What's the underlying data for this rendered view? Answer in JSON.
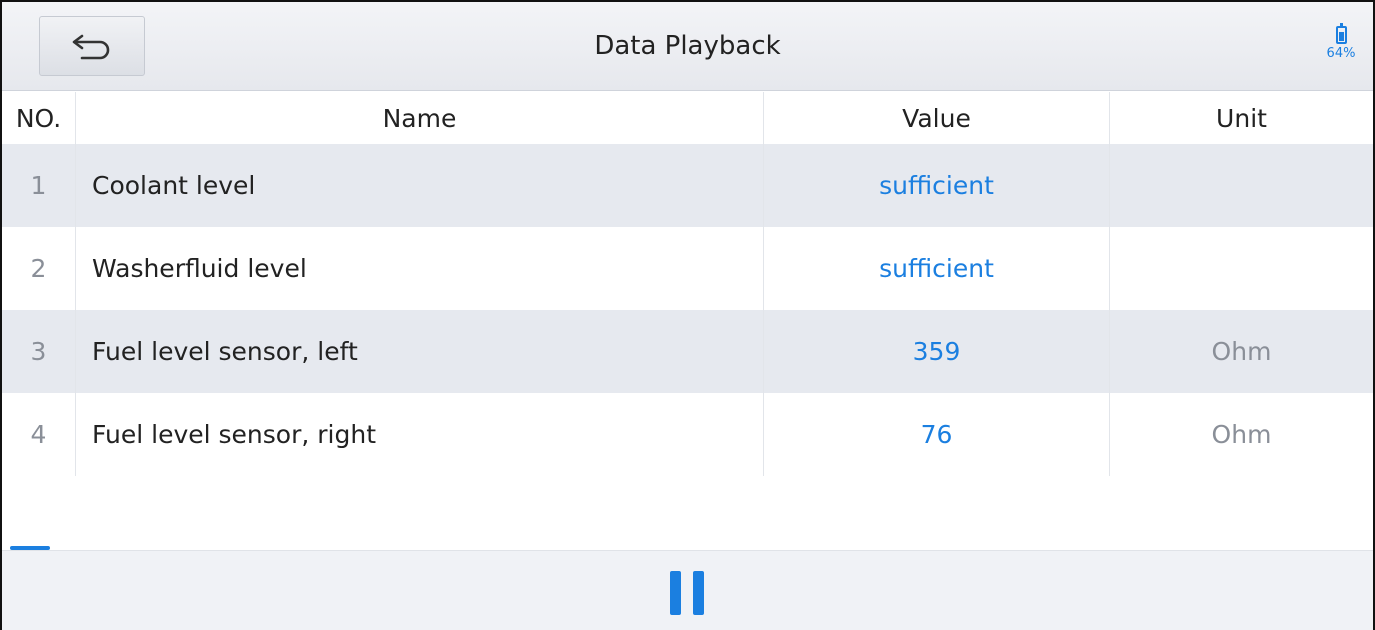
{
  "header": {
    "title": "Data Playback",
    "battery_text": "64%",
    "battery_level": 0.64,
    "back_icon": "back-arrow-icon"
  },
  "table": {
    "columns": [
      "NO.",
      "Name",
      "Value",
      "Unit"
    ],
    "rows": [
      {
        "no": "1",
        "name": "Coolant level",
        "value": "sufficient",
        "unit": ""
      },
      {
        "no": "2",
        "name": "Washerfluid level",
        "value": "sufficient",
        "unit": ""
      },
      {
        "no": "3",
        "name": "Fuel level sensor, left",
        "value": "359",
        "unit": "Ohm"
      },
      {
        "no": "4",
        "name": "Fuel level sensor, right",
        "value": "76",
        "unit": "Ohm"
      }
    ]
  },
  "playback": {
    "progress": 0.03,
    "control_icon": "pause-icon"
  },
  "colors": {
    "accent": "#1b7fe0",
    "row_shade": "#e6e9ef",
    "header_bg": "#e8eaef"
  }
}
